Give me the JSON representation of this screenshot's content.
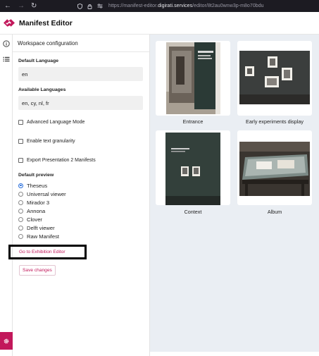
{
  "browser": {
    "url_prefix": "https://manifest-editor.",
    "url_domain": "digirati.services",
    "url_path": "/editor/8t2au0wnw3p-m8o70bdu"
  },
  "app": {
    "title": "Manifest Editor",
    "brand_color": "#c2185b"
  },
  "rail": {
    "icons": [
      "info-icon",
      "list-icon",
      "gear-icon"
    ]
  },
  "panel": {
    "title": "Workspace configuration",
    "default_language": {
      "label": "Default Language",
      "value": "en"
    },
    "available_languages": {
      "label": "Available Languages",
      "value": "en, cy, nl, fr"
    },
    "checkboxes": [
      {
        "label": "Advanced Language Mode",
        "checked": false
      },
      {
        "label": "Enable text granularity",
        "checked": false
      },
      {
        "label": "Export Presentation 2 Manifests",
        "checked": false
      }
    ],
    "default_preview": {
      "label": "Default preview",
      "options": [
        "Theseus",
        "Universal viewer",
        "Mirador 3",
        "Annona",
        "Clover",
        "Delft viewer",
        "Raw Manifest"
      ],
      "selected": "Theseus"
    },
    "exhibition_link": "Go to Exhibition Editor",
    "save_button": "Save changes"
  },
  "canvases": [
    {
      "label": "Entrance"
    },
    {
      "label": "Early experiments display"
    },
    {
      "label": "Context"
    },
    {
      "label": "Album"
    }
  ]
}
